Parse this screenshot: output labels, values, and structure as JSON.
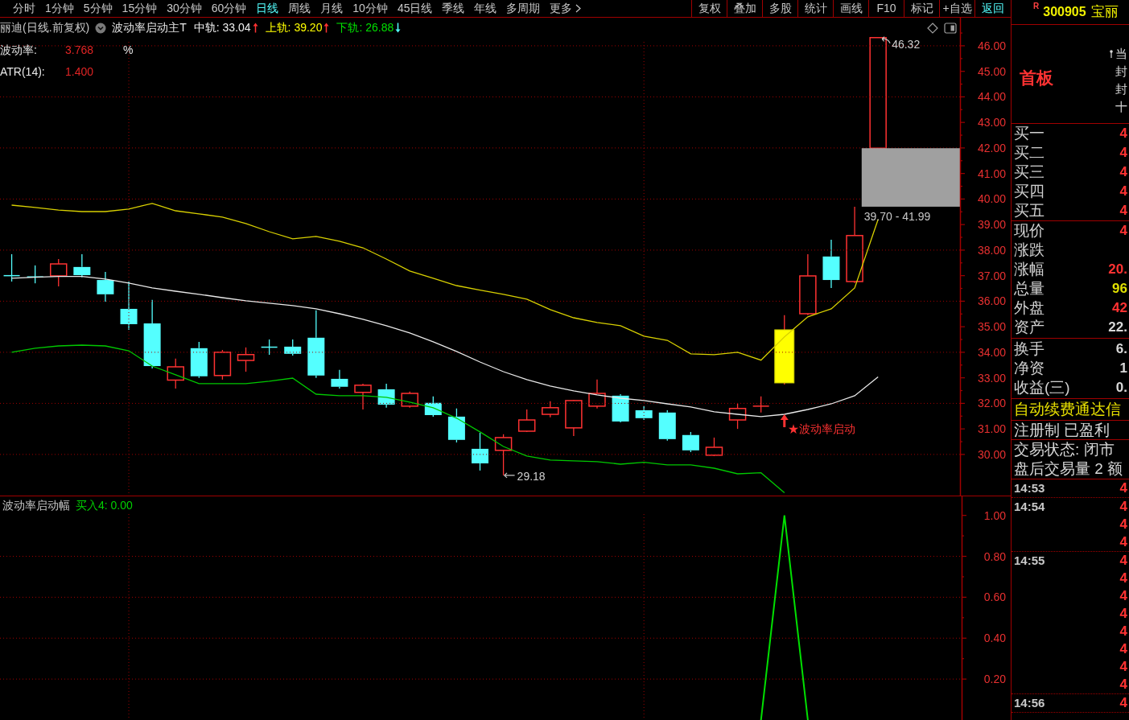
{
  "toolbar": {
    "periods": [
      {
        "label": "分时",
        "selected": false,
        "kind": "period"
      },
      {
        "label": "1分钟",
        "selected": false,
        "kind": "period"
      },
      {
        "label": "5分钟",
        "selected": false,
        "kind": "period"
      },
      {
        "label": "15分钟",
        "selected": false,
        "kind": "period"
      },
      {
        "label": "30分钟",
        "selected": false,
        "kind": "period"
      },
      {
        "label": "60分钟",
        "selected": false,
        "kind": "period"
      },
      {
        "label": "日线",
        "selected": true,
        "kind": "period"
      },
      {
        "label": "周线",
        "selected": false,
        "kind": "period"
      },
      {
        "label": "月线",
        "selected": false,
        "kind": "period"
      },
      {
        "label": "10分钟",
        "selected": false,
        "kind": "period"
      },
      {
        "label": "45日线",
        "selected": false,
        "kind": "period"
      },
      {
        "label": "季线",
        "selected": false,
        "kind": "period"
      },
      {
        "label": "年线",
        "selected": false,
        "kind": "period"
      },
      {
        "label": "多周期",
        "selected": false,
        "kind": "period"
      },
      {
        "label": "更多",
        "selected": false,
        "kind": "menu"
      }
    ],
    "tools": [
      {
        "label": "复权",
        "active": false
      },
      {
        "label": "叠加",
        "active": false
      },
      {
        "label": "多股",
        "active": false
      },
      {
        "label": "统计",
        "active": false
      },
      {
        "label": "画线",
        "active": false
      },
      {
        "label": "F10",
        "active": false
      },
      {
        "label": "标记",
        "active": false
      },
      {
        "label": "+自选",
        "active": false
      },
      {
        "label": "返回",
        "active": true
      }
    ]
  },
  "main_chart": {
    "title": "丽迪(日线.前复权)",
    "indicator": "波动率启动主T",
    "readouts": [
      {
        "text": "中轨: 33.04",
        "rising": true,
        "color": "#f0f0f0"
      },
      {
        "text": "上轨: 39.20",
        "rising": true,
        "color": "#ffff00"
      },
      {
        "text": "下轨: 26.88",
        "rising": false,
        "color": "#00e000"
      }
    ],
    "stats": [
      {
        "label": "波动率:",
        "value": "3.768",
        "unit": "%"
      },
      {
        "label": "ATR(14):",
        "value": "1.400"
      }
    ],
    "chart_data": {
      "type": "line",
      "categories": [
        null,
        null,
        null,
        null,
        null,
        null,
        null,
        null,
        null,
        null,
        null,
        null,
        null,
        null,
        null,
        null,
        null,
        null,
        null,
        null,
        null,
        null,
        null,
        null,
        null,
        null,
        null,
        null,
        null,
        null,
        null,
        null,
        null,
        null,
        null,
        null,
        null,
        null,
        null,
        null,
        null
      ],
      "ylim": [
        28.39,
        47.1
      ],
      "yticks": [
        {
          "value": 30,
          "label": "30.00"
        },
        {
          "value": 31,
          "label": "31.00"
        },
        {
          "value": 32,
          "label": "32.00"
        },
        {
          "value": 33,
          "label": "33.00"
        },
        {
          "value": 34,
          "label": "34.00"
        },
        {
          "value": 35,
          "label": "35.00"
        },
        {
          "value": 36,
          "label": "36.00"
        },
        {
          "value": 37,
          "label": "37.00"
        },
        {
          "value": 38,
          "label": "38.00"
        },
        {
          "value": 39,
          "label": "39.00"
        },
        {
          "value": 40,
          "label": "40.00"
        },
        {
          "value": 41,
          "label": "41.00"
        },
        {
          "value": 42,
          "label": "42.00"
        },
        {
          "value": 43,
          "label": "43.00"
        },
        {
          "value": 44,
          "label": "44.00"
        },
        {
          "value": 45,
          "label": "45.00"
        },
        {
          "value": 46,
          "label": "46.00"
        }
      ],
      "grid": true,
      "series": [
        {
          "color": "#d8d000",
          "values": [
            39.76,
            39.67,
            39.57,
            39.51,
            39.51,
            39.61,
            39.83,
            39.54,
            39.42,
            39.29,
            39.04,
            38.72,
            38.44,
            38.54,
            38.35,
            38.09,
            37.65,
            37.18,
            36.9,
            36.61,
            36.43,
            36.27,
            36.08,
            35.67,
            35.35,
            35.17,
            35.04,
            34.63,
            34.47,
            33.94,
            33.91,
            34.0,
            33.69,
            34.6,
            35.39,
            35.7,
            36.52,
            39.2,
            null,
            null,
            null
          ]
        },
        {
          "color": "#e8e8e8",
          "values": [
            36.9,
            36.94,
            36.97,
            36.97,
            36.87,
            36.71,
            36.52,
            36.39,
            36.27,
            36.14,
            36.02,
            35.92,
            35.83,
            35.7,
            35.51,
            35.29,
            35.04,
            34.76,
            34.41,
            34.03,
            33.62,
            33.24,
            32.93,
            32.68,
            32.49,
            32.33,
            32.2,
            32.11,
            31.98,
            31.86,
            31.67,
            31.57,
            31.48,
            31.57,
            31.76,
            31.98,
            32.3,
            33.04,
            null,
            null,
            null
          ]
        },
        {
          "color": "#00c800",
          "values": [
            34.0,
            34.16,
            34.25,
            34.28,
            34.25,
            34.06,
            33.46,
            33.12,
            32.77,
            32.77,
            32.77,
            32.87,
            32.99,
            32.36,
            32.3,
            32.3,
            32.24,
            32.05,
            31.83,
            31.42,
            30.88,
            30.31,
            29.94,
            29.78,
            29.75,
            29.72,
            29.62,
            29.69,
            29.59,
            29.59,
            29.46,
            29.24,
            29.28,
            28.5,
            null,
            null,
            null,
            null,
            null,
            null,
            null
          ]
        }
      ],
      "annotations": [
        {
          "text": "46.32"
        },
        {
          "text": "39.70 - 41.99"
        },
        {
          "text": "★波动率启动"
        },
        {
          "text": "29.18"
        }
      ]
    }
  },
  "lower_chart": {
    "title": "波动率启动幅",
    "readout": "买入4: 0.00",
    "chart_data": {
      "type": "line",
      "categories": [
        null,
        null,
        null,
        null,
        null,
        null,
        null,
        null,
        null,
        null,
        null,
        null,
        null,
        null,
        null,
        null,
        null,
        null,
        null,
        null,
        null,
        null,
        null,
        null,
        null,
        null,
        null,
        null,
        null,
        null,
        null,
        null,
        null,
        null,
        null,
        null,
        null,
        null,
        null,
        null,
        null
      ],
      "ylim": [
        0,
        1.093
      ],
      "yticks": [
        {
          "value": 0.2,
          "label": "0.20"
        },
        {
          "value": 0.4,
          "label": "0.40"
        },
        {
          "value": 0.6,
          "label": "0.60"
        },
        {
          "value": 0.8,
          "label": "0.80"
        },
        {
          "value": 1,
          "label": "1.00"
        }
      ],
      "grid": true,
      "series": [
        {
          "color": "#00e000",
          "values": [
            null,
            null,
            null,
            null,
            null,
            null,
            null,
            null,
            null,
            null,
            null,
            null,
            null,
            null,
            null,
            null,
            null,
            null,
            null,
            null,
            null,
            null,
            null,
            null,
            null,
            null,
            null,
            null,
            null,
            null,
            null,
            null,
            0,
            1,
            0,
            null,
            null,
            null,
            null,
            null,
            null
          ]
        }
      ]
    }
  },
  "quote_panel": {
    "market_badge": "R",
    "code": "300905",
    "name": "宝丽",
    "board": "首板",
    "notes": [
      {
        "text": "当",
        "kind": "pinned"
      },
      {
        "text": "封",
        "kind": "plain"
      },
      {
        "text": "封",
        "kind": "plain"
      },
      {
        "text": "十",
        "kind": "plain"
      }
    ],
    "bids": [
      {
        "label": "买一",
        "value": "4"
      },
      {
        "label": "买二",
        "value": "4"
      },
      {
        "label": "买三",
        "value": "4"
      },
      {
        "label": "买四",
        "value": "4"
      },
      {
        "label": "买五",
        "value": "4"
      }
    ],
    "quotes": [
      {
        "label": "现价",
        "value": "4",
        "color": "#ff3232"
      },
      {
        "label": "涨跌"
      },
      {
        "label": "涨幅",
        "value": "20.",
        "color": "#ff3232"
      },
      {
        "label": "总量",
        "value": "96",
        "color": "#e0e000"
      },
      {
        "label": "外盘",
        "value": "42",
        "color": "#ff3232"
      },
      {
        "label": "资产",
        "value": "22.",
        "color": "#d8d8d8"
      }
    ],
    "fundamentals": [
      {
        "label": "换手",
        "value": "6."
      },
      {
        "label": "净资",
        "value": "1"
      },
      {
        "label": "收益(三)",
        "value": "0."
      }
    ],
    "promo": "自动续费通达信",
    "tags": "注册制 已盈利",
    "status_lines": [
      "交易状态: 闭市",
      "盘后交易量 2 额"
    ],
    "trades": [
      {
        "time": "14:53",
        "prices": [
          "4"
        ]
      },
      {
        "time": "14:54",
        "prices": [
          "4",
          "4",
          "4"
        ]
      },
      {
        "time": "14:55",
        "prices": [
          "4",
          "4",
          "4",
          "4",
          "4",
          "4",
          "4",
          "4"
        ]
      },
      {
        "time": "14:56",
        "prices": [
          "4"
        ]
      }
    ]
  }
}
